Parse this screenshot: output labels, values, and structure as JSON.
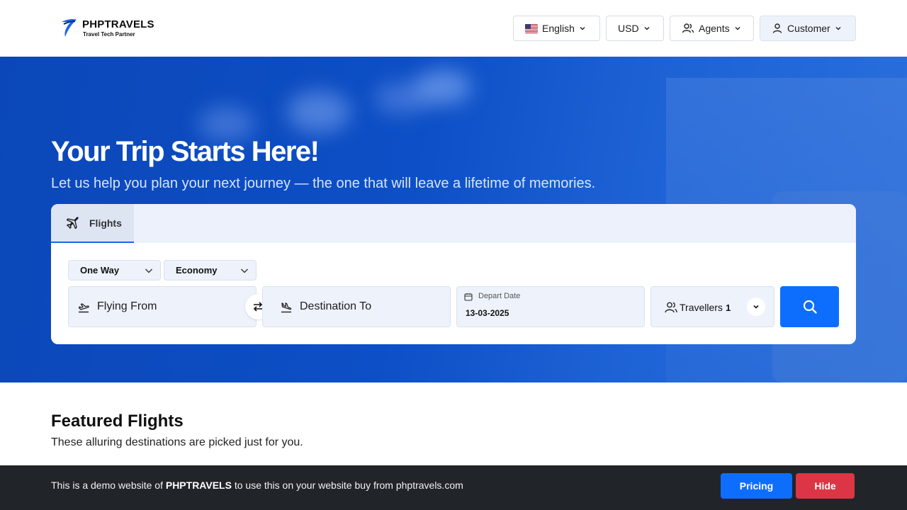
{
  "brand": {
    "name": "PHPTRAVELS",
    "tagline": "Travel Tech Partner"
  },
  "nav": {
    "language": "English",
    "currency": "USD",
    "agents": "Agents",
    "customer": "Customer"
  },
  "hero": {
    "title": "Your Trip Starts Here!",
    "subtitle": "Let us help you plan your next journey — the one that will leave a lifetime of memories."
  },
  "search": {
    "tab_label": "Flights",
    "trip_type": "One Way",
    "cabin_class": "Economy",
    "from_placeholder": "Flying From",
    "to_placeholder": "Destination To",
    "depart_label": "Depart Date",
    "depart_value": "13-03-2025",
    "travellers_label": "Travellers",
    "travellers_count": "1"
  },
  "featured": {
    "title": "Featured Flights",
    "subtitle": "These alluring destinations are picked just for you."
  },
  "banner": {
    "text_before": "This is a demo website of",
    "brand": "PHPTRAVELS",
    "text_after": "to use this on your website buy from phptravels.com",
    "pricing_label": "Pricing",
    "hide_label": "Hide"
  },
  "colors": {
    "primary": "#0d6efd",
    "danger": "#dc3545",
    "hero_bg": "#0d4fc6",
    "banner_bg": "#212529"
  },
  "icons": [
    "us-flag-icon",
    "chevron-down-icon",
    "users-icon",
    "user-icon",
    "airplane-icon",
    "takeoff-icon",
    "landing-icon",
    "swap-icon",
    "calendar-icon",
    "search-icon"
  ]
}
